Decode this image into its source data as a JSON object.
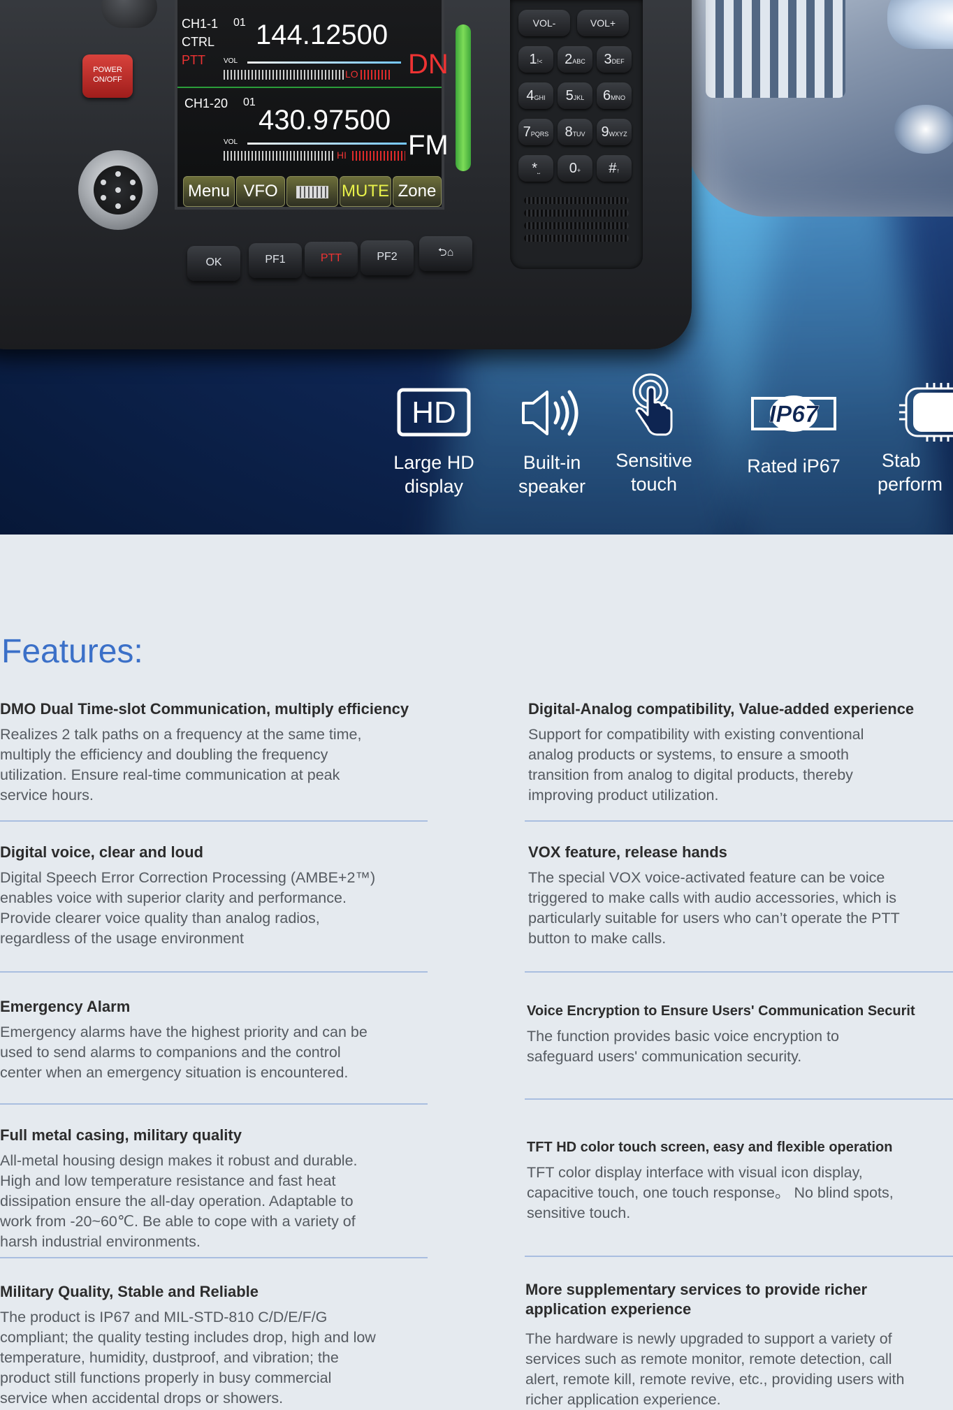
{
  "radio": {
    "power_label_1": "POWER",
    "power_label_2": "ON/OFF",
    "ch1_label": "CH1-1",
    "ch1_id": "01",
    "ctrl_label": "CTRL",
    "ptt_label": "PTT",
    "vol_label": "VOL",
    "lo_label": "LO",
    "freq1": "144.12500",
    "mode1": "DN",
    "ch2_label": "CH1-20",
    "ch2_id": "01",
    "freq2": "430.97500",
    "hi_label": "HI",
    "mode2": "FM",
    "softkeys": [
      "Menu",
      "VFO",
      "",
      "MUTE",
      "Zone"
    ],
    "hwkeys": [
      "OK",
      "PF1",
      "PTT",
      "PF2",
      ""
    ],
    "vol_minus": "VOL-",
    "vol_plus": "VOL+",
    "keys": [
      {
        "main": "1",
        "sub": "!<"
      },
      {
        "main": "2",
        "sub": "ABC"
      },
      {
        "main": "3",
        "sub": "DEF"
      },
      {
        "main": "4",
        "sub": "GHI"
      },
      {
        "main": "5",
        "sub": "JKL"
      },
      {
        "main": "6",
        "sub": "MNO"
      },
      {
        "main": "7",
        "sub": "PQRS"
      },
      {
        "main": "8",
        "sub": "TUV"
      },
      {
        "main": "9",
        "sub": "WXYZ"
      },
      {
        "main": "*",
        "sub": "⎵"
      },
      {
        "main": "0",
        "sub": "+"
      },
      {
        "main": "#",
        "sub": "↑"
      }
    ]
  },
  "highlights": [
    {
      "icon": "hd-display-icon",
      "line1": "Large HD",
      "line2": "display"
    },
    {
      "icon": "speaker-icon",
      "line1": "Built-in",
      "line2": "speaker"
    },
    {
      "icon": "touch-icon",
      "line1": "Sensitive",
      "line2": "touch"
    },
    {
      "icon": "ip67-icon",
      "line1": "Rated iP67",
      "line2": ""
    },
    {
      "icon": "chip-icon",
      "line1": "Stab",
      "line2": "perform"
    }
  ],
  "hd_badge": "HD",
  "ip_badge": "IP67",
  "features_title": "Features:",
  "features": [
    {
      "title": "DMO Dual Time-slot Communication, multiply efficiency",
      "lines": [
        "Realizes 2 talk paths on a frequency at the same time,",
        "multiply the efficiency and doubling the frequency",
        "utilization. Ensure real-time communication at peak",
        "service hours."
      ]
    },
    {
      "title": "Digital-Analog compatibility, Value-added experience",
      "lines": [
        "Support for compatibility with existing conventional",
        "analog products or systems, to ensure a smooth",
        "transition from analog to digital products, thereby",
        "improving product utilization."
      ]
    },
    {
      "title": "Digital voice, clear and loud",
      "lines": [
        "Digital Speech Error Correction Processing (AMBE+2™)",
        "enables voice with superior clarity and performance.",
        "Provide clearer voice quality than analog radios,",
        "regardless of the usage environment"
      ]
    },
    {
      "title": "VOX feature, release hands",
      "lines": [
        "The special VOX voice-activated feature can be voice",
        "triggered to make calls with audio accessories, which is",
        "particularly suitable for users who can’t operate the PTT",
        "button to make calls."
      ]
    },
    {
      "title": "Emergency Alarm",
      "lines": [
        "Emergency alarms have the highest priority and can be",
        "used to send alarms to companions and the control",
        "center when an emergency situation is encountered."
      ]
    },
    {
      "title": "Voice Encryption to Ensure Users' Communication Securit",
      "lines": [
        "The function provides basic voice encryption to",
        "safeguard users' communication security."
      ]
    },
    {
      "title": "Full metal casing, military quality",
      "lines": [
        "All-metal housing design makes it robust and durable.",
        "High and low temperature resistance and fast heat",
        "dissipation ensure the all-day operation. Adaptable to",
        "work from -20~60℃. Be able to cope with a variety of",
        "harsh industrial environments."
      ]
    },
    {
      "title": "TFT HD color touch screen, easy and flexible operation",
      "lines": [
        "TFT color display interface with visual icon display,",
        "capacitive touch, one touch response。 No blind spots,",
        "sensitive touch."
      ]
    },
    {
      "title": "Military Quality, Stable and Reliable",
      "lines": [
        "The product is IP67 and MIL-STD-810 C/D/E/F/G",
        "compliant; the quality testing includes drop, high and low",
        "temperature, humidity, dustproof, and vibration; the",
        "product still functions properly in busy commercial",
        "service when accidental drops or showers."
      ]
    },
    {
      "title_lines": [
        "More supplementary services to provide richer",
        "application experience"
      ],
      "lines": [
        "The hardware is newly upgraded to support a variety of",
        "services such as remote monitor, remote detection, call",
        "alert, remote kill, remote revive, etc., providing users with",
        "richer application experience."
      ]
    }
  ],
  "colors": {
    "accent": "#3b70c8",
    "rule": "#a9bee0",
    "hero_dark": "#071838",
    "page_bg": "#e5eaef"
  }
}
